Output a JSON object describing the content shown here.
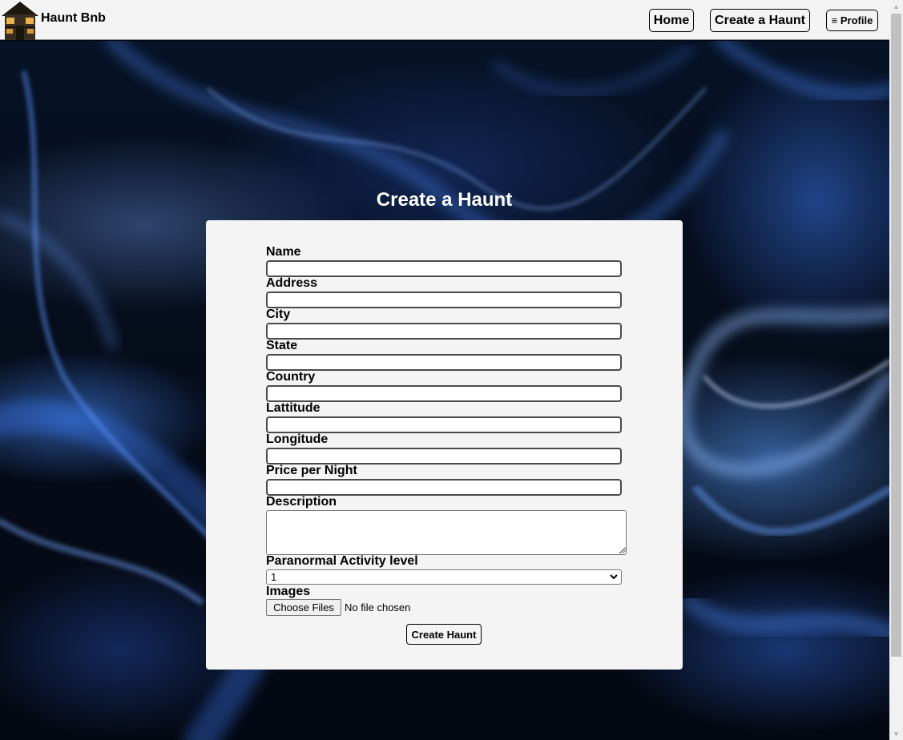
{
  "nav": {
    "brand": "Haunt Bnb",
    "logo_icon": "haunted-house-icon",
    "home": "Home",
    "create": "Create a Haunt",
    "profile": "≡ Profile"
  },
  "page": {
    "title": "Create a Haunt"
  },
  "form": {
    "name_label": "Name",
    "address_label": "Address",
    "city_label": "City",
    "state_label": "State",
    "country_label": "Country",
    "latitude_label": "Lattitude",
    "longitude_label": "Longitude",
    "price_label": "Price per Night",
    "description_label": "Description",
    "activity_label": "Paranormal Activity level",
    "activity_value": "1",
    "images_label": "Images",
    "choose_files": "Choose Files",
    "file_status": "No file chosen",
    "submit": "Create Haunt"
  },
  "colors": {
    "card_bg": "#f4f4f4",
    "navbar_bg": "#f4f4f4",
    "title_text": "#ffffff",
    "background_smoke": "#1e5fd6"
  }
}
